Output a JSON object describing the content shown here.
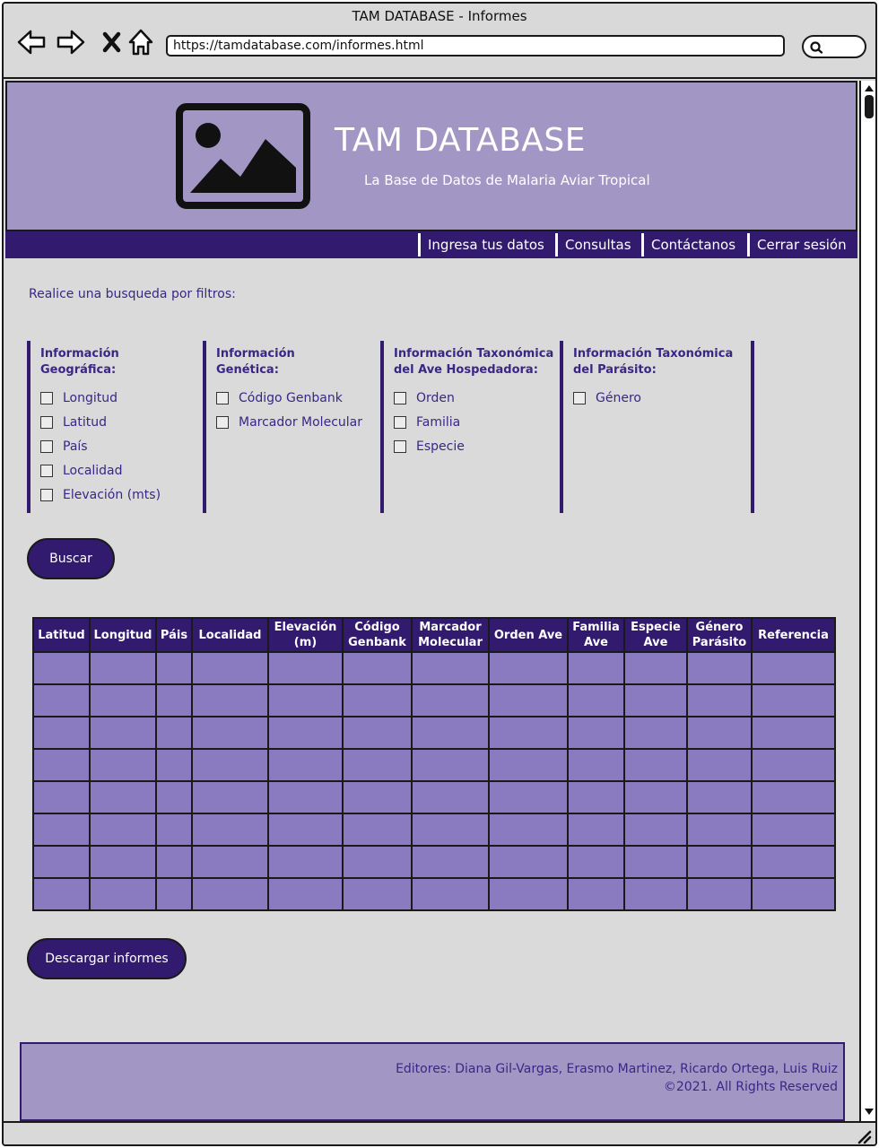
{
  "window": {
    "title": "TAM DATABASE - Informes",
    "url": "https://tamdatabase.com/informes.html"
  },
  "header": {
    "title": "TAM DATABASE",
    "subtitle": "La Base de Datos de Malaria Aviar Tropical"
  },
  "nav": {
    "items": [
      {
        "label": "Ingresa tus datos"
      },
      {
        "label": "Consultas"
      },
      {
        "label": "Contáctanos"
      },
      {
        "label": "Cerrar sesión"
      }
    ]
  },
  "search": {
    "intro": "Realice una busqueda por filtros:",
    "groups": [
      {
        "title_line1": "Información",
        "title_line2": "Geográfica:",
        "options": [
          {
            "label": "Longitud",
            "checked": false
          },
          {
            "label": "Latitud",
            "checked": false
          },
          {
            "label": "País",
            "checked": false
          },
          {
            "label": "Localidad",
            "checked": false
          },
          {
            "label": "Elevación (mts)",
            "checked": false
          }
        ]
      },
      {
        "title_line1": "Información",
        "title_line2": "Genética:",
        "options": [
          {
            "label": "Código Genbank",
            "checked": false
          },
          {
            "label": "Marcador Molecular",
            "checked": false
          }
        ]
      },
      {
        "title_line1": "Información Taxonómica",
        "title_line2": "del Ave Hospedadora:",
        "options": [
          {
            "label": "Orden",
            "checked": false
          },
          {
            "label": "Familia",
            "checked": false
          },
          {
            "label": "Especie",
            "checked": false
          }
        ]
      },
      {
        "title_line1": "Información Taxonómica",
        "title_line2": "del Parásito:",
        "options": [
          {
            "label": "Género",
            "checked": false
          }
        ]
      }
    ],
    "button_label": "Buscar"
  },
  "results": {
    "columns": [
      {
        "line1": "Latitud",
        "line2": ""
      },
      {
        "line1": "Longitud",
        "line2": ""
      },
      {
        "line1": "Páis",
        "line2": ""
      },
      {
        "line1": "Localidad",
        "line2": ""
      },
      {
        "line1": "Elevación",
        "line2": "(m)"
      },
      {
        "line1": "Código",
        "line2": "Genbank"
      },
      {
        "line1": "Marcador",
        "line2": "Molecular"
      },
      {
        "line1": "Orden Ave",
        "line2": ""
      },
      {
        "line1": "Familia",
        "line2": "Ave"
      },
      {
        "line1": "Especie",
        "line2": "Ave"
      },
      {
        "line1": "Género",
        "line2": "Parásito"
      },
      {
        "line1": "Referencia",
        "line2": ""
      }
    ],
    "rows": [
      [
        "",
        "",
        "",
        "",
        "",
        "",
        "",
        "",
        "",
        "",
        "",
        ""
      ],
      [
        "",
        "",
        "",
        "",
        "",
        "",
        "",
        "",
        "",
        "",
        "",
        ""
      ],
      [
        "",
        "",
        "",
        "",
        "",
        "",
        "",
        "",
        "",
        "",
        "",
        ""
      ],
      [
        "",
        "",
        "",
        "",
        "",
        "",
        "",
        "",
        "",
        "",
        "",
        ""
      ],
      [
        "",
        "",
        "",
        "",
        "",
        "",
        "",
        "",
        "",
        "",
        "",
        ""
      ],
      [
        "",
        "",
        "",
        "",
        "",
        "",
        "",
        "",
        "",
        "",
        "",
        ""
      ],
      [
        "",
        "",
        "",
        "",
        "",
        "",
        "",
        "",
        "",
        "",
        "",
        ""
      ],
      [
        "",
        "",
        "",
        "",
        "",
        "",
        "",
        "",
        "",
        "",
        "",
        ""
      ]
    ],
    "download_label": "Descargar informes"
  },
  "footer": {
    "editors": "Editores: Diana Gil-Vargas, Erasmo Martinez, Ricardo Ortega, Luis Ruiz",
    "copyright": "©2021. All Rights Reserved"
  },
  "colors": {
    "header_bg": "#a297c4",
    "nav_bg": "#321a6e",
    "table_cell": "#8a7ac0",
    "text_accent": "#3a2685"
  },
  "icons": {
    "back": "arrow-left-icon",
    "forward": "arrow-right-icon",
    "stop": "close-icon",
    "home": "home-icon",
    "search": "search-icon",
    "logo": "image-placeholder-icon"
  }
}
